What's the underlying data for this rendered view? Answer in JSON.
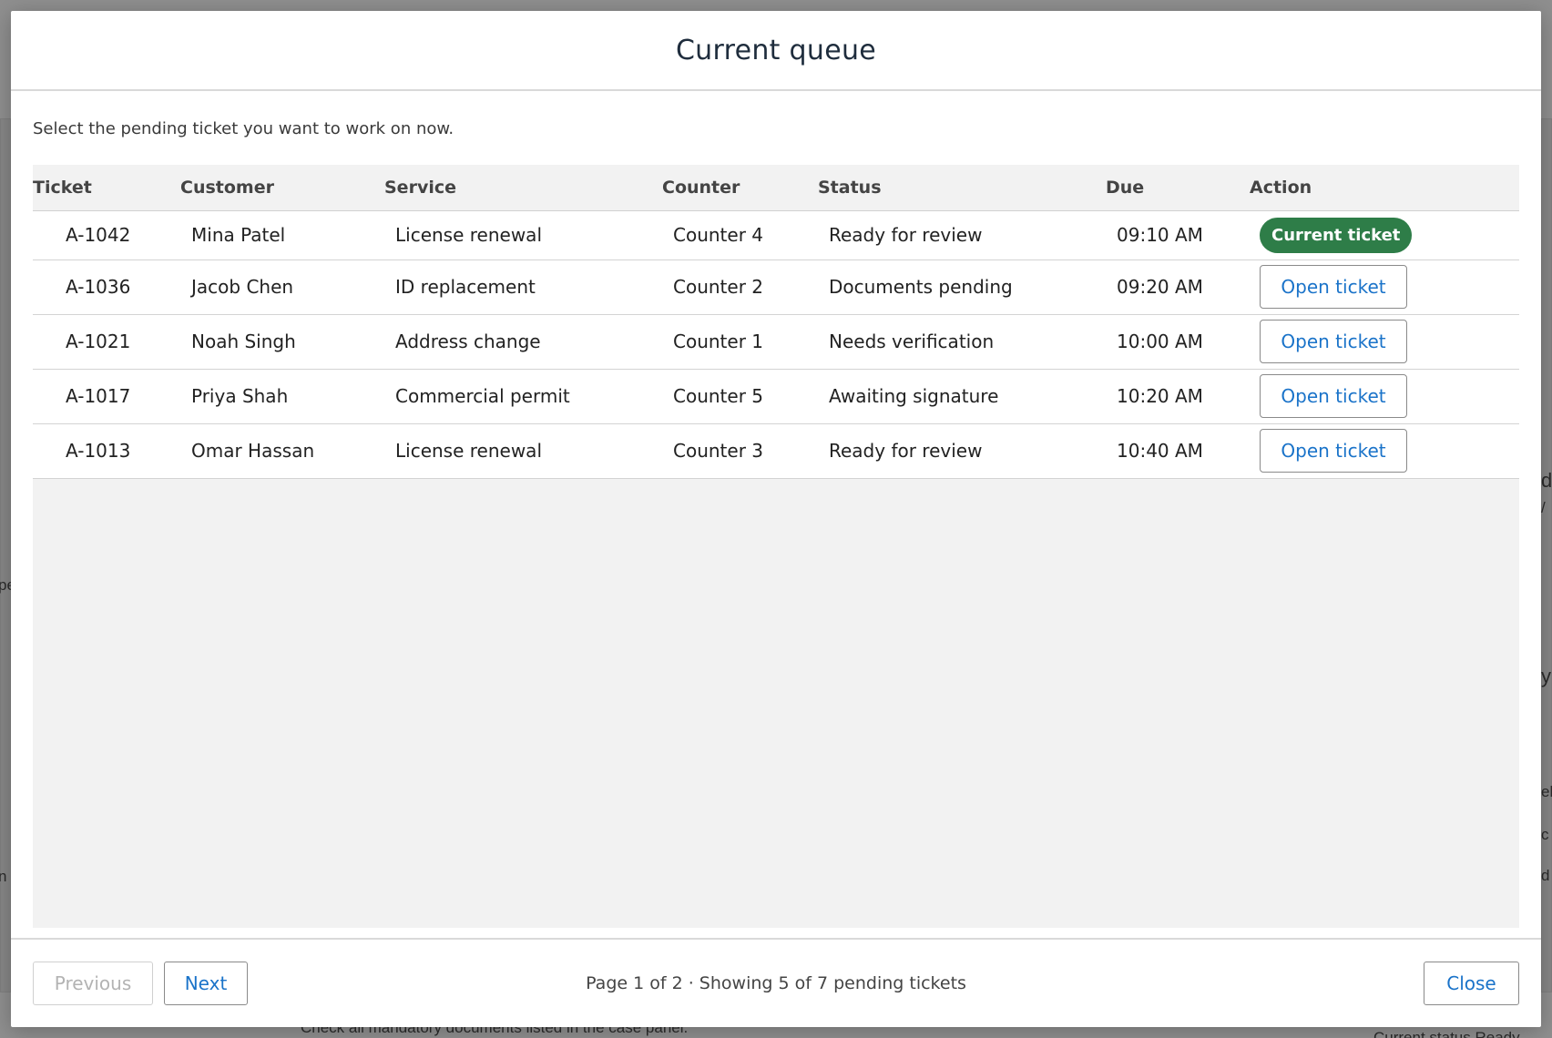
{
  "background": {
    "fragments": [
      "pe",
      "n",
      "Check all mandatory documents listed in the case panel.",
      "d",
      "/",
      "y",
      "el",
      "c",
      "d",
      "Current status  Ready"
    ]
  },
  "modal": {
    "title": "Current queue",
    "instruction": "Select the pending ticket you want to work on now.",
    "columns": [
      "Ticket",
      "Customer",
      "Service",
      "Counter",
      "Status",
      "Due",
      "Action"
    ],
    "rows": [
      {
        "ticket": "A-1042",
        "customer": "Mina Patel",
        "service": "License renewal",
        "counter": "Counter 4",
        "status": "Ready for review",
        "due": "09:10 AM",
        "action": "Current ticket"
      },
      {
        "ticket": "A-1036",
        "customer": "Jacob Chen",
        "service": "ID replacement",
        "counter": "Counter 2",
        "status": "Documents pending",
        "due": "09:20 AM",
        "action": "Open ticket"
      },
      {
        "ticket": "A-1021",
        "customer": "Noah Singh",
        "service": "Address change",
        "counter": "Counter 1",
        "status": "Needs verification",
        "due": "10:00 AM",
        "action": "Open ticket"
      },
      {
        "ticket": "A-1017",
        "customer": "Priya Shah",
        "service": "Commercial permit",
        "counter": "Counter 5",
        "status": "Awaiting signature",
        "due": "10:20 AM",
        "action": "Open ticket"
      },
      {
        "ticket": "A-1013",
        "customer": "Omar Hassan",
        "service": "License renewal",
        "counter": "Counter 3",
        "status": "Ready for review",
        "due": "10:40 AM",
        "action": "Open ticket"
      }
    ],
    "footer": {
      "previous": "Previous",
      "next": "Next",
      "pager": "Page 1 of 2 · Showing 5 of 7 pending tickets",
      "close": "Close"
    }
  },
  "colors": {
    "accent": "#1a73c9",
    "current_badge": "#2e7d48",
    "overlay": "#8f8f8f"
  }
}
